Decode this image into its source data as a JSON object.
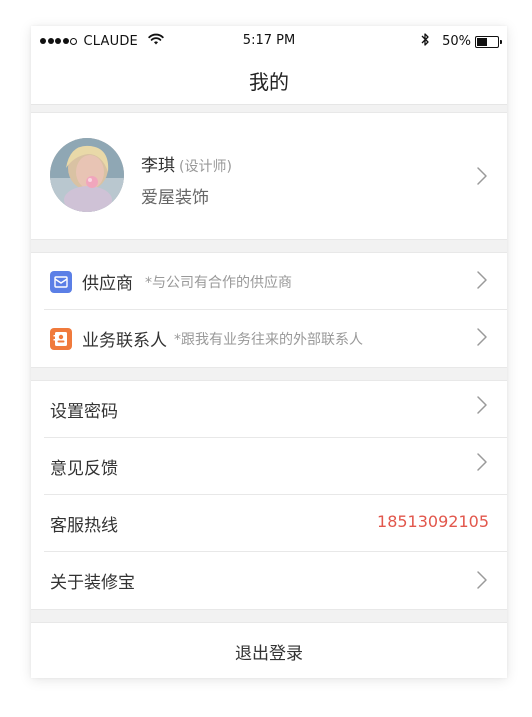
{
  "status_bar": {
    "carrier": "CLAUDE",
    "time": "5:17 PM",
    "battery_text": "50%",
    "battery_level": 0.5,
    "signal_bars": 4,
    "signal_total": 5
  },
  "navbar": {
    "title": "我的"
  },
  "profile": {
    "name": "李琪",
    "role": "(设计师)",
    "company": "爱屋装饰"
  },
  "contacts": [
    {
      "label": "供应商",
      "hint": "*与公司有合作的供应商",
      "icon": "supplier-icon",
      "icon_color": "#5b7fe6"
    },
    {
      "label": "业务联系人",
      "hint": "*跟我有业务往来的外部联系人",
      "icon": "contact-card-icon",
      "icon_color": "#f07a3c"
    }
  ],
  "settings": [
    {
      "label": "设置密码",
      "value": ""
    },
    {
      "label": "意见反馈",
      "value": ""
    },
    {
      "label": "客服热线",
      "value": "18513092105"
    },
    {
      "label": "关于装修宝",
      "value": ""
    }
  ],
  "logout": {
    "label": "退出登录"
  },
  "colors": {
    "accent": "#e2574c",
    "background": "#f2f2f2"
  }
}
